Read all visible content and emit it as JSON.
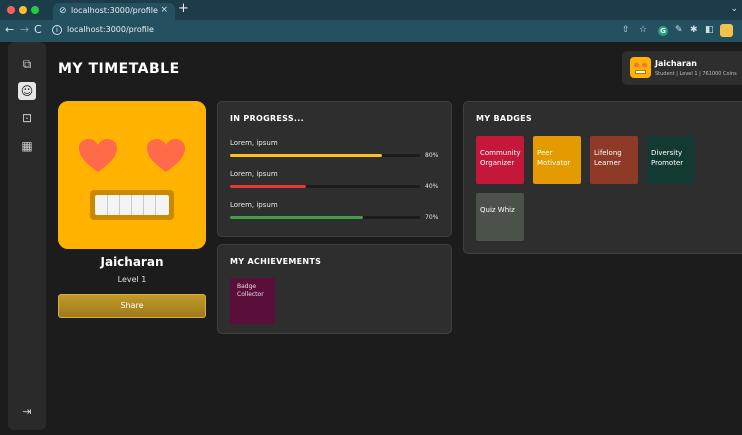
{
  "browser": {
    "tab_title": "localhost:3000/profile",
    "url": "localhost:3000/profile"
  },
  "header": {
    "title": "MY TIMETABLE"
  },
  "user": {
    "name": "Jaicharan",
    "meta": "Student | Level 1 | 761000 Coins"
  },
  "profile": {
    "name": "Jaicharan",
    "level": "Level 1",
    "share_label": "Share"
  },
  "progress": {
    "title": "IN PROGRESS...",
    "items": [
      {
        "label": "Lorem, ipsum",
        "percent": 80,
        "pct_text": "80%",
        "color": "#ffc21a"
      },
      {
        "label": "Lorem, ipsum",
        "percent": 40,
        "pct_text": "40%",
        "color": "#e53935"
      },
      {
        "label": "Lorem, ipsum",
        "percent": 70,
        "pct_text": "70%",
        "color": "#43a047"
      }
    ]
  },
  "achievements": {
    "title": "MY ACHIEVEMENTS",
    "items": [
      {
        "label": "Badge Collector",
        "color": "#5a0e3a"
      }
    ]
  },
  "badges": {
    "title": "MY BADGES",
    "items": [
      {
        "label": "Community Organizer",
        "color": "#c4173a"
      },
      {
        "label": "Peer Motivator",
        "color": "#e39b00"
      },
      {
        "label": "Lifelong Learner",
        "color": "#8e3a26"
      },
      {
        "label": "Diversity Promoter",
        "color": "#123a33"
      },
      {
        "label": "Quiz Whiz",
        "color": "#4a5249"
      }
    ]
  },
  "sidebar": {
    "icons": [
      "copy-icon",
      "profile-icon",
      "bag-icon",
      "calendar-icon"
    ],
    "logout_icon": "logout-icon"
  }
}
